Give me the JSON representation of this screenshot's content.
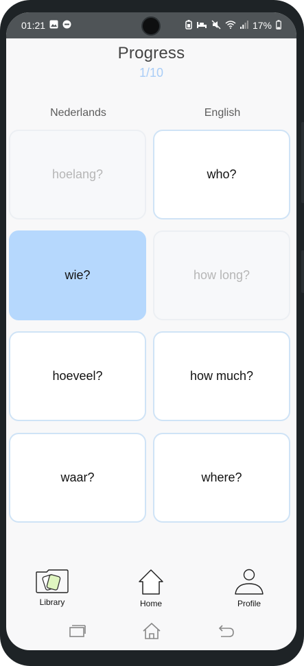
{
  "status": {
    "time": "01:21",
    "battery": "17%"
  },
  "header": {
    "title": "Progress",
    "progress": "1/10"
  },
  "columns": {
    "left": "Nederlands",
    "right": "English"
  },
  "cards": {
    "left": [
      "hoelang?",
      "wie?",
      "hoeveel?",
      "waar?"
    ],
    "right": [
      "who?",
      "how long?",
      "how much?",
      "where?"
    ]
  },
  "nav": {
    "library": "Library",
    "home": "Home",
    "profile": "Profile"
  },
  "icons": {
    "library": "cards-library-icon",
    "home": "house-icon",
    "profile": "person-icon"
  },
  "colors": {
    "accent": "#b6d8fd",
    "card_border": "#cfe3f6",
    "progress_text": "#a9cdf7"
  }
}
